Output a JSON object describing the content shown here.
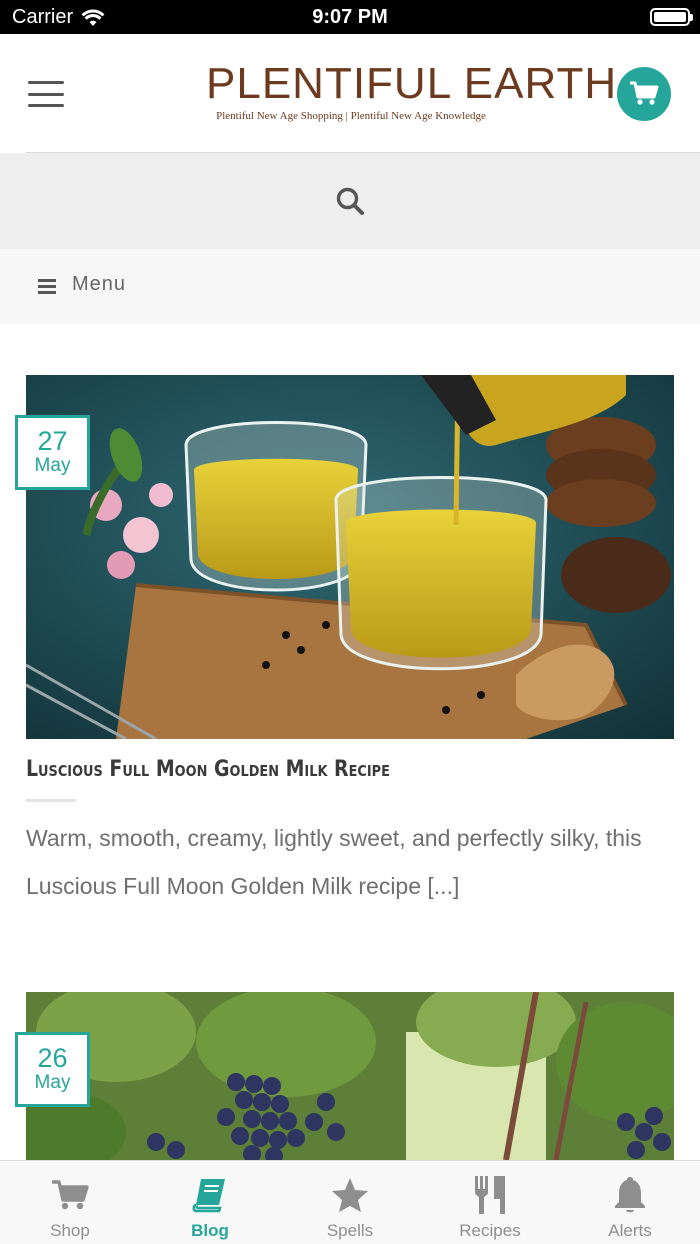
{
  "status_bar": {
    "carrier": "Carrier",
    "time": "9:07 PM"
  },
  "header": {
    "logo_title_part1": "PLENTIFUL",
    "logo_title_part2": "EARTH",
    "logo_tagline": "Plentiful New Age Shopping | Plentiful New Age Knowledge"
  },
  "search": {
    "icon": "search-icon"
  },
  "menu": {
    "label": "Menu"
  },
  "posts": [
    {
      "day": "27",
      "month": "May",
      "title": "Luscious Full Moon Golden Milk Recipe",
      "excerpt": "Warm, smooth, creamy, lightly sweet, and perfectly silky, this Luscious Full Moon Golden Milk recipe [...]"
    },
    {
      "day": "26",
      "month": "May"
    }
  ],
  "tabs": [
    {
      "label": "Shop",
      "icon": "cart-icon",
      "active": false
    },
    {
      "label": "Blog",
      "icon": "book-icon",
      "active": true
    },
    {
      "label": "Spells",
      "icon": "star-icon",
      "active": false
    },
    {
      "label": "Recipes",
      "icon": "utensils-icon",
      "active": false
    },
    {
      "label": "Alerts",
      "icon": "bell-icon",
      "active": false
    }
  ],
  "colors": {
    "accent": "#26a69a",
    "brand_brown": "#6b3a1f",
    "tab_inactive": "#8e8e8e"
  }
}
